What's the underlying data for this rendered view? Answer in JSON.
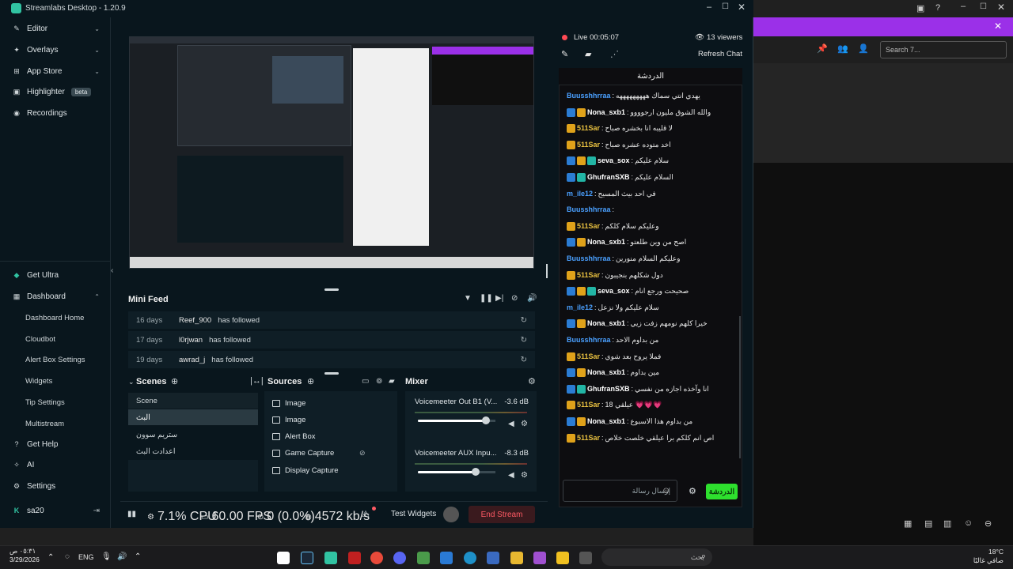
{
  "window": {
    "title": "Streamlabs Desktop - 1.20.9"
  },
  "sidebar": {
    "items": [
      {
        "label": "Editor"
      },
      {
        "label": "Overlays"
      },
      {
        "label": "App Store"
      },
      {
        "label": "Highlighter",
        "badge": "beta"
      },
      {
        "label": "Recordings"
      },
      {
        "label": "Get Ultra"
      },
      {
        "label": "Dashboard"
      },
      {
        "label": "Get Help"
      },
      {
        "label": "AI"
      },
      {
        "label": "Settings"
      }
    ],
    "dashboard_sub": [
      "Dashboard Home",
      "Cloudbot",
      "Alert Box Settings",
      "Widgets",
      "Tip Settings",
      "Multistream"
    ],
    "user": "sa20"
  },
  "minifeed": {
    "title": "Mini Feed",
    "rows": [
      {
        "days": "16 days",
        "user": "Reef_900",
        "action": "has followed"
      },
      {
        "days": "17 days",
        "user": "l0rjwan",
        "action": "has followed"
      },
      {
        "days": "19 days",
        "user": "awrad_j",
        "action": "has followed"
      }
    ]
  },
  "scenes": {
    "title": "Scenes",
    "items": [
      "Scene",
      "البث",
      "ستريم سوون",
      "اعدادت البث"
    ]
  },
  "sources": {
    "title": "Sources",
    "items": [
      "Image",
      "Image",
      "Alert Box",
      "Game Capture",
      "Display Capture"
    ]
  },
  "mixer": {
    "title": "Mixer",
    "channels": [
      {
        "name": "Voicemeeter Out B1 (V...",
        "db": "-3.6 dB",
        "level": 0.88
      },
      {
        "name": "Voicemeeter AUX Inpu...",
        "db": "-8.3 dB",
        "level": 0.74
      }
    ]
  },
  "status": {
    "cpu": "7.1% CPU",
    "fps": "60.00 FPS",
    "dropped": "0 (0.0%)",
    "bitrate": "4572 kb/s",
    "test_widgets": "Test Widgets",
    "end_stream": "End Stream"
  },
  "chat": {
    "live": "Live 00:05:07",
    "viewers": "13 viewers",
    "refresh": "Refresh Chat",
    "header": "الدردشة",
    "messages": [
      {
        "user": "Buusshhrraa",
        "msg": "يهدي انتي سماك هههههههههه",
        "color": "#4aa0ff",
        "badges": []
      },
      {
        "user": "Nona_sxb1",
        "msg": "والله الشوق مليون ارجوووو",
        "color": "#ffffff",
        "badges": [
          "blue",
          "gold"
        ]
      },
      {
        "user": "511Sar",
        "msg": "لا قليبه انا بخشره صباح",
        "color": "#e8c040",
        "badges": [
          "gold"
        ]
      },
      {
        "user": "511Sar",
        "msg": "اخد متوده عشره صباح",
        "color": "#e8c040",
        "badges": [
          "gold"
        ]
      },
      {
        "user": "seva_sox",
        "msg": "سلام عليكم",
        "color": "#ffffff",
        "badges": [
          "blue",
          "gold",
          "teal"
        ]
      },
      {
        "user": "GhufranSXB",
        "msg": "السلام عليكم",
        "color": "#ffffff",
        "badges": [
          "blue",
          "teal"
        ]
      },
      {
        "user": "m_ile12",
        "msg": "في احد بيث المسيح",
        "color": "#4aa0ff",
        "badges": []
      },
      {
        "user": "Buusshhrraa",
        "msg": "",
        "color": "#4aa0ff",
        "badges": []
      },
      {
        "user": "511Sar",
        "msg": "وعليكم سلام كلكم",
        "color": "#e8c040",
        "badges": [
          "gold"
        ]
      },
      {
        "user": "Nona_sxb1",
        "msg": "اصح من وين طلعتو",
        "color": "#ffffff",
        "badges": [
          "blue",
          "gold"
        ]
      },
      {
        "user": "Buusshhrraa",
        "msg": "وعليكم السلام منورين",
        "color": "#4aa0ff",
        "badges": []
      },
      {
        "user": "511Sar",
        "msg": "دول شكلهم بنجيبون",
        "color": "#e8c040",
        "badges": [
          "gold"
        ]
      },
      {
        "user": "seva_sox",
        "msg": "صحيحت ورجع انام",
        "color": "#ffffff",
        "badges": [
          "blue",
          "gold",
          "teal"
        ]
      },
      {
        "user": "m_ile12",
        "msg": "سلام عليكم ولا نزعل",
        "color": "#4aa0ff",
        "badges": []
      },
      {
        "user": "Nona_sxb1",
        "msg": "خيرا كلهم نومهم زفت زيي",
        "color": "#ffffff",
        "badges": [
          "blue",
          "gold"
        ]
      },
      {
        "user": "Buusshhrraa",
        "msg": "من بداوم الاحد",
        "color": "#4aa0ff",
        "badges": []
      },
      {
        "user": "511Sar",
        "msg": "فملا يروح بعد شوي",
        "color": "#e8c040",
        "badges": [
          "gold"
        ]
      },
      {
        "user": "Nona_sxb1",
        "msg": "مين بداوم",
        "color": "#ffffff",
        "badges": [
          "blue",
          "gold"
        ]
      },
      {
        "user": "GhufranSXB",
        "msg": "انا وآخذه اجازه من نفسي",
        "color": "#ffffff",
        "badges": [
          "blue",
          "teal"
        ]
      },
      {
        "user": "511Sar",
        "msg": "18 عيلقي 💗💗💗",
        "color": "#e8c040",
        "badges": [
          "gold"
        ]
      },
      {
        "user": "Nona_sxb1",
        "msg": "من بداوم هذا الاسبوع",
        "color": "#ffffff",
        "badges": [
          "blue",
          "gold"
        ]
      },
      {
        "user": "511Sar",
        "msg": "اص انم كلكم برا عيلقي خلصت خلاص",
        "color": "#e8c040",
        "badges": [
          "gold"
        ]
      }
    ],
    "input_placeholder": "إرسال رسالة",
    "send_label": "الدردشة"
  },
  "browser": {
    "search_placeholder": "Search 7..."
  },
  "taskbar": {
    "time": "٠٥:٣١ ص",
    "date": "3/29/2026",
    "lang": "ENG",
    "search": "بحث",
    "weather_temp": "18°C",
    "weather_desc": "صافي غالبًا"
  },
  "colors": {
    "accent": "#31c3a2",
    "end_stream": "#ff5a64",
    "chat_send": "#2ee02e"
  }
}
